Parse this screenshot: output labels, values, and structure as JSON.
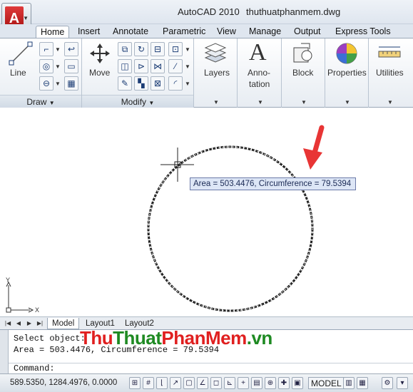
{
  "window": {
    "app_name": "AutoCAD 2010",
    "file_name": "thuthuatphanmem.dwg"
  },
  "tabs": [
    "Home",
    "Insert",
    "Annotate",
    "Parametric",
    "View",
    "Manage",
    "Output",
    "Express Tools"
  ],
  "ribbon": {
    "draw": {
      "title": "Draw",
      "line_label": "Line"
    },
    "modify": {
      "title": "Modify",
      "move_label": "Move"
    },
    "layers_label": "Layers",
    "annotation_label_1": "Anno-",
    "annotation_label_2": "tation",
    "annotation_glyph": "A",
    "block_label": "Block",
    "properties_label": "Properties",
    "utilities_label": "Utilities"
  },
  "canvas": {
    "tooltip": "Area = 503.4476, Circumference = 79.5394",
    "ucs_x": "X",
    "ucs_y": "Y"
  },
  "layout_tabs": [
    "Model",
    "Layout1",
    "Layout2"
  ],
  "command": {
    "line1": "Select object:",
    "line2": "Area = 503.4476, Circumference = 79.5394",
    "prompt": "Command:"
  },
  "watermark": {
    "part1": "Thu",
    "part2": "Thuat",
    "part3": "PhanMem",
    "part4": ".vn"
  },
  "status": {
    "coordinates": "589.5350, 1284.4976, 0.0000",
    "model_label": "MODEL"
  },
  "colors": {
    "arrow": "#e83535",
    "tooltip_bg": "#dde6f6",
    "logo_red": "#c01818"
  }
}
